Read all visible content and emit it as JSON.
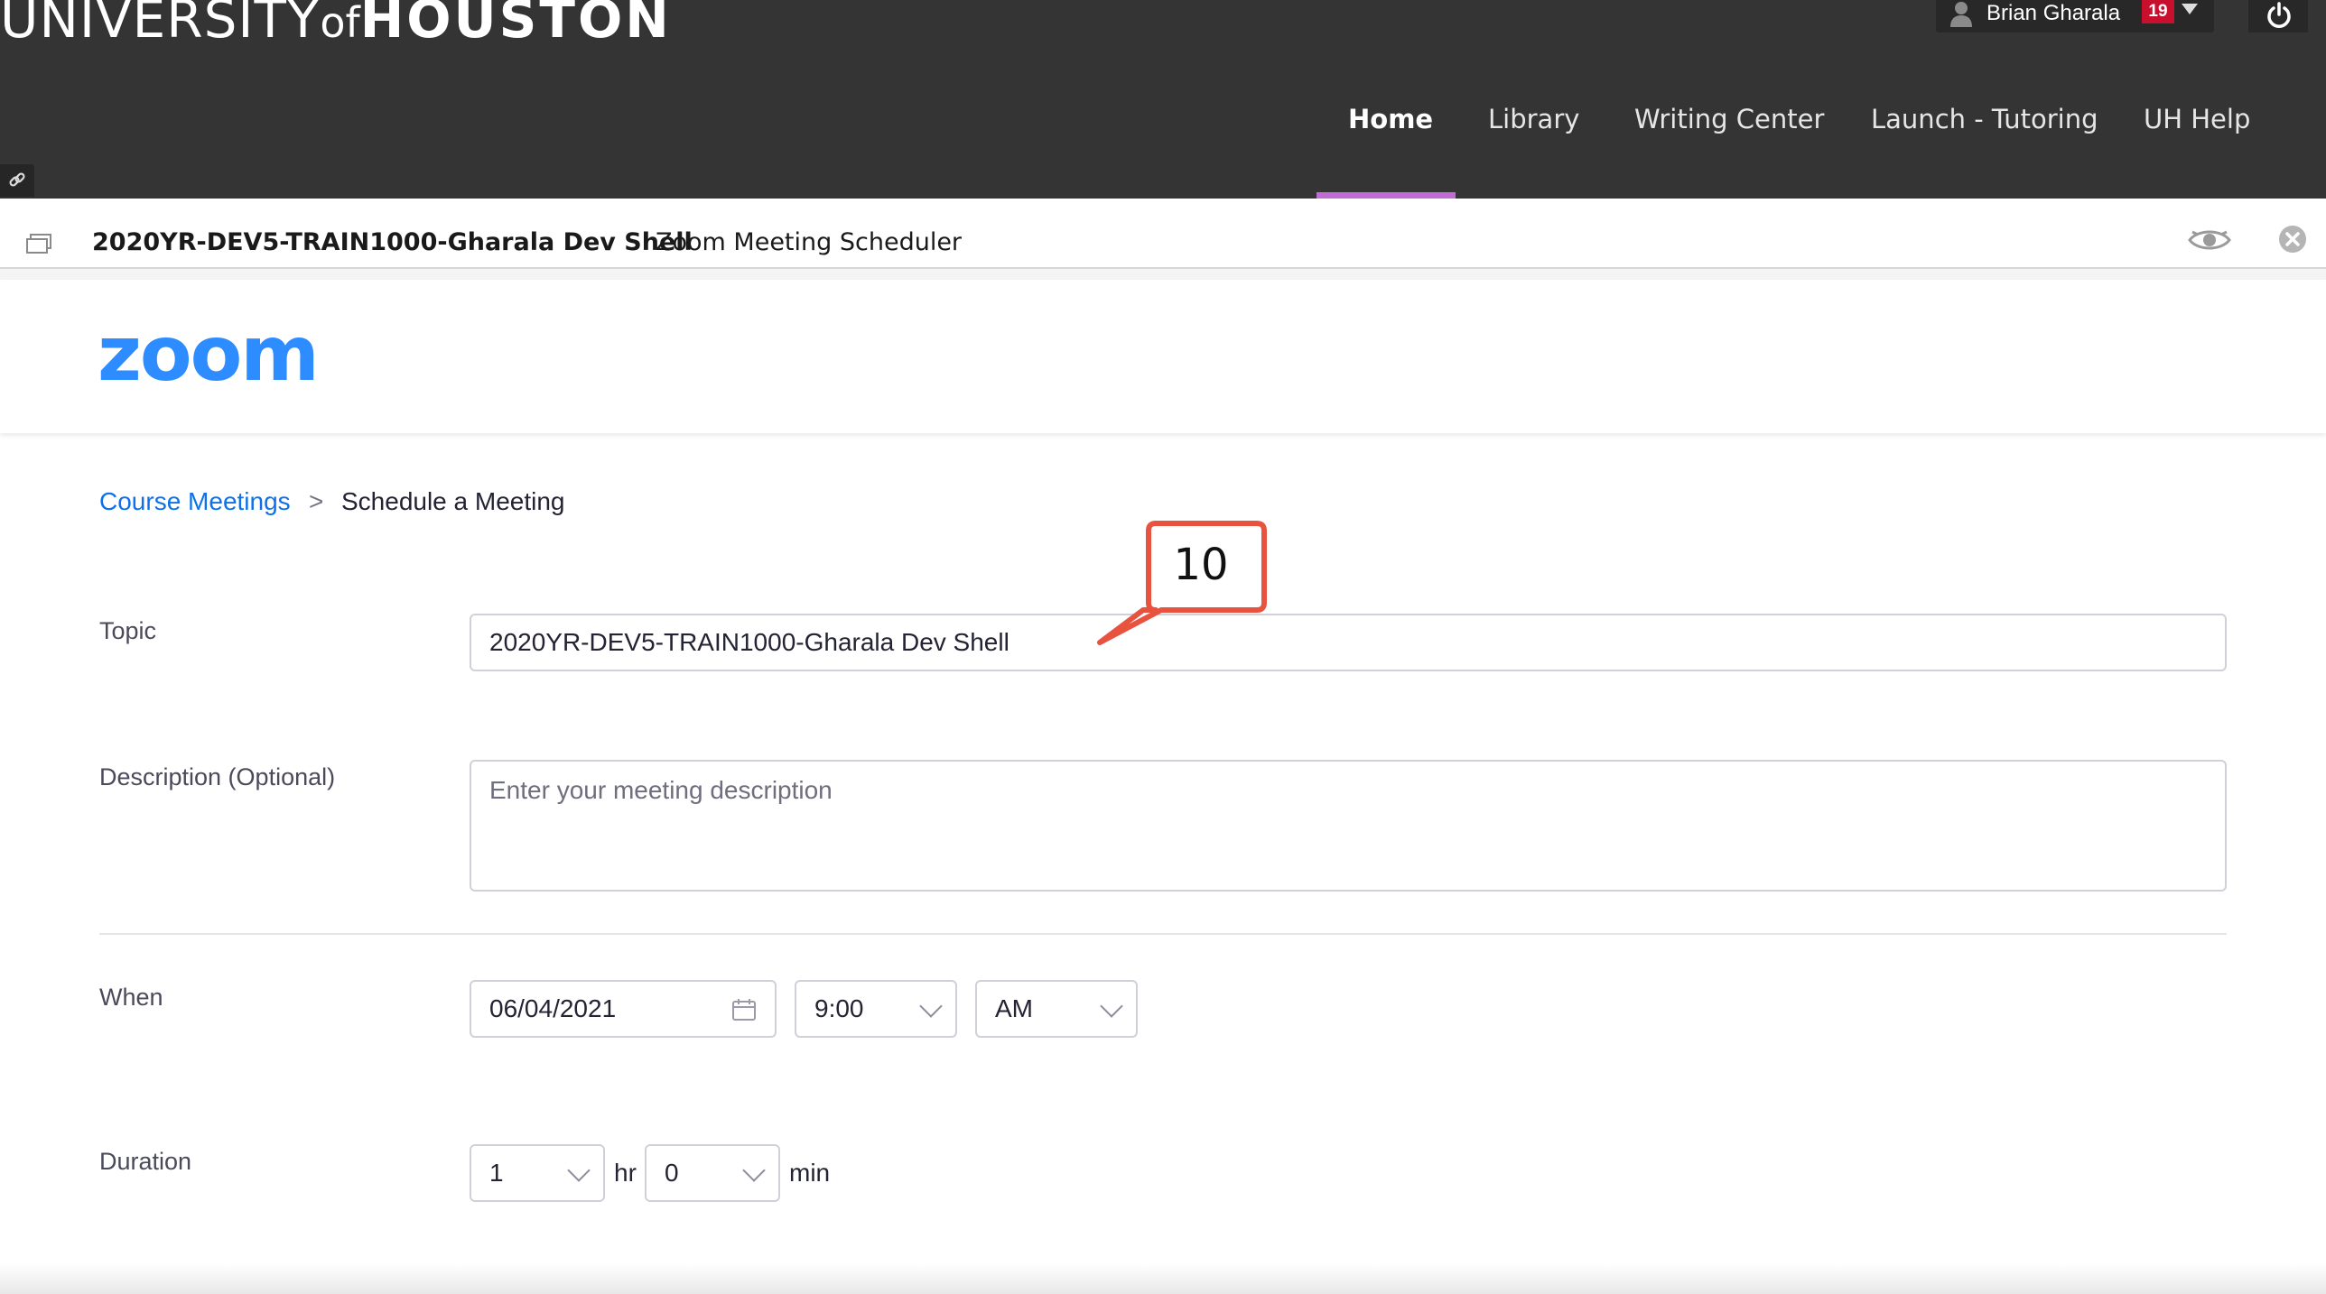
{
  "header": {
    "brand_part1": "UNIVERSITY",
    "brand_part2": "of",
    "brand_part3": "HOUSTON",
    "user_name": "Brian Gharala",
    "notification_count": "19",
    "nav": [
      {
        "label": "Home",
        "active": true
      },
      {
        "label": "Library"
      },
      {
        "label": "Writing Center"
      },
      {
        "label": "Launch - Tutoring"
      },
      {
        "label": "UH Help"
      }
    ]
  },
  "course_bar": {
    "course_name": "2020YR-DEV5-TRAIN1000-Gharala Dev Shell",
    "tool_name": "Zoom Meeting Scheduler"
  },
  "zoom": {
    "logo_text": "zoom",
    "brand_color": "#2d8cff"
  },
  "breadcrumb": {
    "parent": "Course Meetings",
    "separator": ">",
    "current": "Schedule a Meeting"
  },
  "form": {
    "topic_label": "Topic",
    "topic_value": "2020YR-DEV5-TRAIN1000-Gharala Dev Shell",
    "description_label": "Description (Optional)",
    "description_placeholder": "Enter your meeting description",
    "when_label": "When",
    "date_value": "06/04/2021",
    "time_value": "9:00",
    "ampm_value": "AM",
    "duration_label": "Duration",
    "duration_hours": "1",
    "hours_unit": "hr",
    "duration_minutes": "0",
    "minutes_unit": "min"
  },
  "annotation": {
    "callout_number": "10",
    "callout_color": "#e8533f"
  },
  "icons": {
    "user": "user-icon",
    "power": "power-icon",
    "link": "link-icon",
    "course": "course-window-icon",
    "eye": "student-preview-eye-icon",
    "close": "close-icon",
    "calendar": "calendar-icon",
    "chevron": "chevron-down-icon"
  }
}
